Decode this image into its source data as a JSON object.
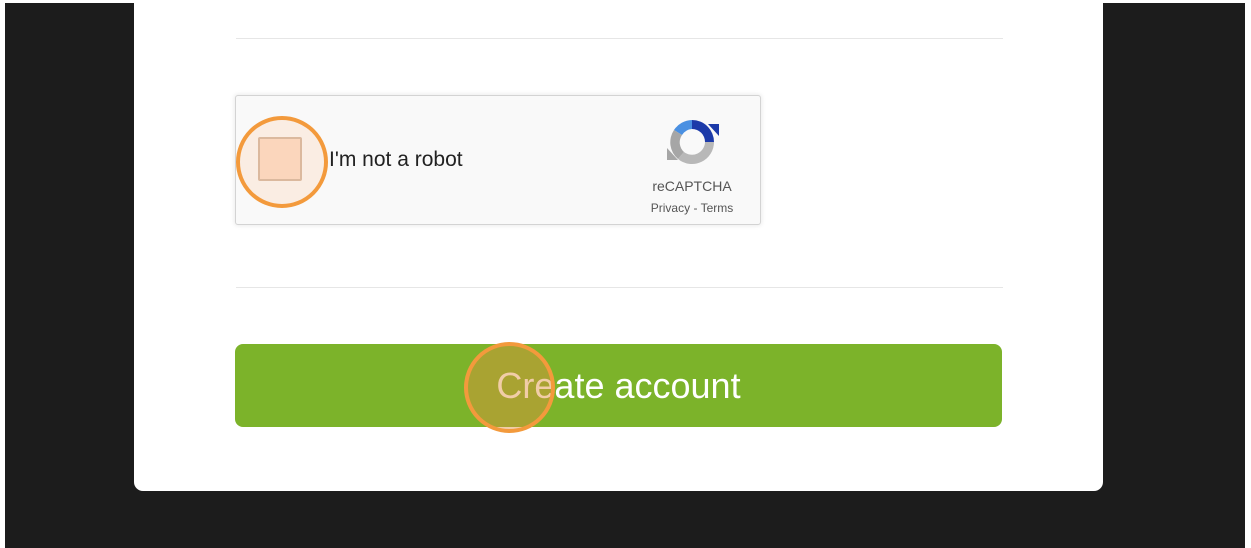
{
  "recaptcha": {
    "checkbox_label": "I'm not a robot",
    "brand": "reCAPTCHA",
    "privacy_link": "Privacy",
    "separator": " - ",
    "terms_link": "Terms",
    "checked": false,
    "logo_icon": "recaptcha-logo-icon"
  },
  "form": {
    "submit_label": "Create account"
  },
  "colors": {
    "backdrop": "#1c1c1c",
    "card": "#ffffff",
    "primary_button": "#7cb32a",
    "click_highlight": "#f39a3c"
  }
}
